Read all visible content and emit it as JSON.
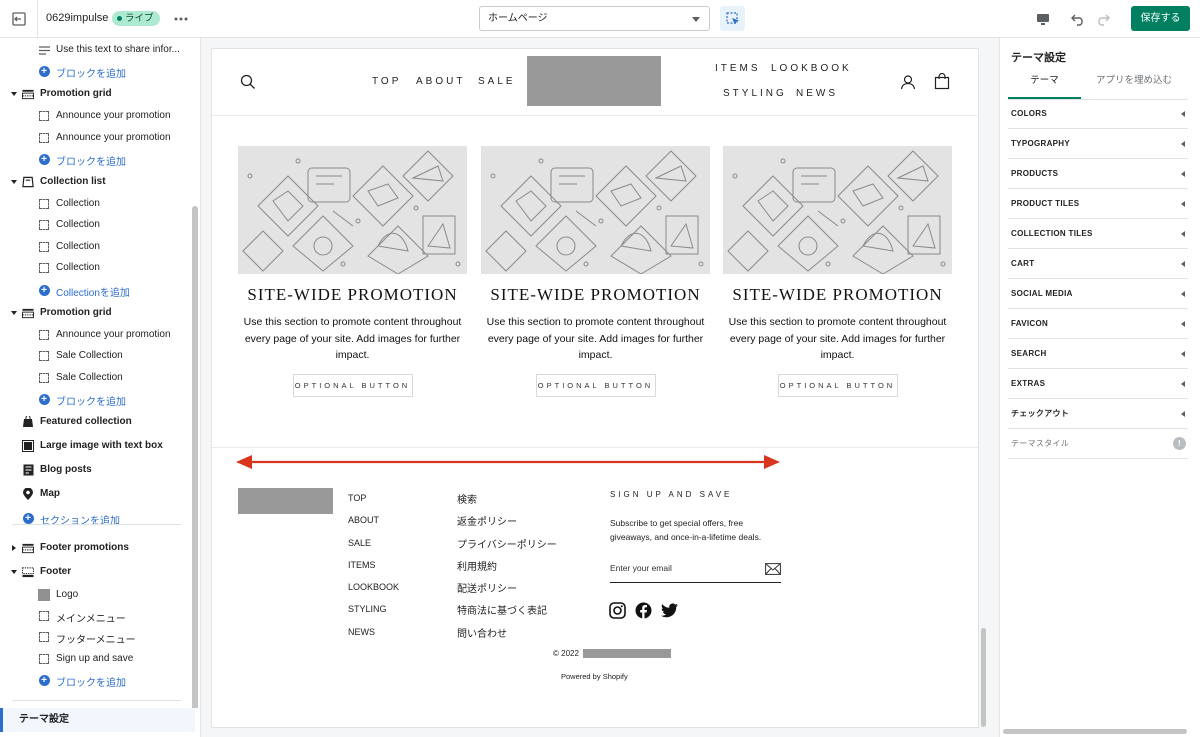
{
  "topbar": {
    "store_name": "0629impulse",
    "live_badge": "ライブ",
    "page_select": "ホームページ",
    "save_label": "保存する"
  },
  "left": {
    "rows": [
      {
        "kind": "block",
        "icon": "text-lines-icon",
        "label": "Use this text to share infor..."
      },
      {
        "kind": "add",
        "label": "ブロックを追加"
      },
      {
        "kind": "section",
        "icon": "promotion-grid-icon",
        "label": "Promotion grid",
        "expanded": true
      },
      {
        "kind": "block",
        "icon": "block-icon",
        "label": "Announce your promotion"
      },
      {
        "kind": "block",
        "icon": "block-icon",
        "label": "Announce your promotion"
      },
      {
        "kind": "add",
        "label": "ブロックを追加"
      },
      {
        "kind": "section",
        "icon": "collection-list-icon",
        "label": "Collection list",
        "expanded": true
      },
      {
        "kind": "block",
        "icon": "block-icon",
        "label": "Collection"
      },
      {
        "kind": "block",
        "icon": "block-icon",
        "label": "Collection"
      },
      {
        "kind": "block",
        "icon": "block-icon",
        "label": "Collection"
      },
      {
        "kind": "block",
        "icon": "block-icon",
        "label": "Collection"
      },
      {
        "kind": "add",
        "label": "Collectionを追加"
      },
      {
        "kind": "section",
        "icon": "promotion-grid-icon",
        "label": "Promotion grid",
        "expanded": true
      },
      {
        "kind": "block",
        "icon": "block-icon",
        "label": "Announce your promotion"
      },
      {
        "kind": "block",
        "icon": "block-icon",
        "label": "Sale Collection"
      },
      {
        "kind": "block",
        "icon": "block-icon",
        "label": "Sale Collection"
      },
      {
        "kind": "add",
        "label": "ブロックを追加"
      },
      {
        "kind": "section",
        "icon": "featured-collection-icon",
        "label": "Featured collection",
        "expanded": false
      },
      {
        "kind": "section",
        "icon": "image-text-icon",
        "label": "Large image with text box",
        "expanded": false
      },
      {
        "kind": "section",
        "icon": "blog-icon",
        "label": "Blog posts",
        "expanded": false
      },
      {
        "kind": "section",
        "icon": "map-pin-icon",
        "label": "Map",
        "expanded": false
      },
      {
        "kind": "addsection",
        "label": "セクションを追加"
      },
      {
        "kind": "section",
        "icon": "promotion-grid-icon",
        "label": "Footer promotions",
        "expanded": false,
        "collapsed_caret": true
      },
      {
        "kind": "section",
        "icon": "footer-icon",
        "label": "Footer",
        "expanded": true
      },
      {
        "kind": "block",
        "icon": "logo-block-icon",
        "label": "Logo"
      },
      {
        "kind": "block",
        "icon": "block-icon",
        "label": "メインメニュー"
      },
      {
        "kind": "block",
        "icon": "block-icon",
        "label": "フッターメニュー"
      },
      {
        "kind": "block",
        "icon": "block-icon",
        "label": "Sign up and save"
      },
      {
        "kind": "add",
        "label": "ブロックを追加"
      }
    ],
    "bottom_selected": "テーマ設定"
  },
  "preview": {
    "nav_left": [
      "TOP",
      "ABOUT",
      "SALE"
    ],
    "nav_right_top": [
      "ITEMS",
      "LOOKBOOK"
    ],
    "nav_right_bottom": [
      "STYLING",
      "NEWS"
    ],
    "promos": [
      {
        "title": "SITE-WIDE PROMOTION",
        "text": "Use this section to promote content throughout every page of your site. Add images for further impact.",
        "button": "OPTIONAL BUTTON"
      },
      {
        "title": "SITE-WIDE PROMOTION",
        "text": "Use this section to promote content throughout every page of your site. Add images for further impact.",
        "button": "OPTIONAL BUTTON"
      },
      {
        "title": "SITE-WIDE PROMOTION",
        "text": "Use this section to promote content throughout every page of your site. Add images for further impact.",
        "button": "OPTIONAL BUTTON"
      }
    ],
    "footer_menu": [
      "TOP",
      "ABOUT",
      "SALE",
      "ITEMS",
      "LOOKBOOK",
      "STYLING",
      "NEWS"
    ],
    "footer_menu2": [
      "検索",
      "返金ポリシー",
      "プライバシーポリシー",
      "利用規約",
      "配送ポリシー",
      "特商法に基づく表記",
      "問い合わせ"
    ],
    "signup_title": "SIGN UP AND SAVE",
    "signup_text": "Subscribe to get special offers, free giveaways, and once-in-a-lifetime deals.",
    "email_placeholder": "Enter your email",
    "copyright": "© 2022",
    "powered": "Powered by Shopify",
    "arrow_color": "#d8351e"
  },
  "right": {
    "title": "テーマ設定",
    "tabs": [
      "テーマ",
      "アプリを埋め込む"
    ],
    "items": [
      "COLORS",
      "TYPOGRAPHY",
      "PRODUCTS",
      "PRODUCT TILES",
      "COLLECTION TILES",
      "CART",
      "SOCIAL MEDIA",
      "FAVICON",
      "SEARCH",
      "EXTRAS",
      "チェックアウト",
      "テーマスタイル"
    ]
  },
  "colors": {
    "accent": "#2c6ecb",
    "save": "#008060",
    "live": "#aee9d1"
  }
}
